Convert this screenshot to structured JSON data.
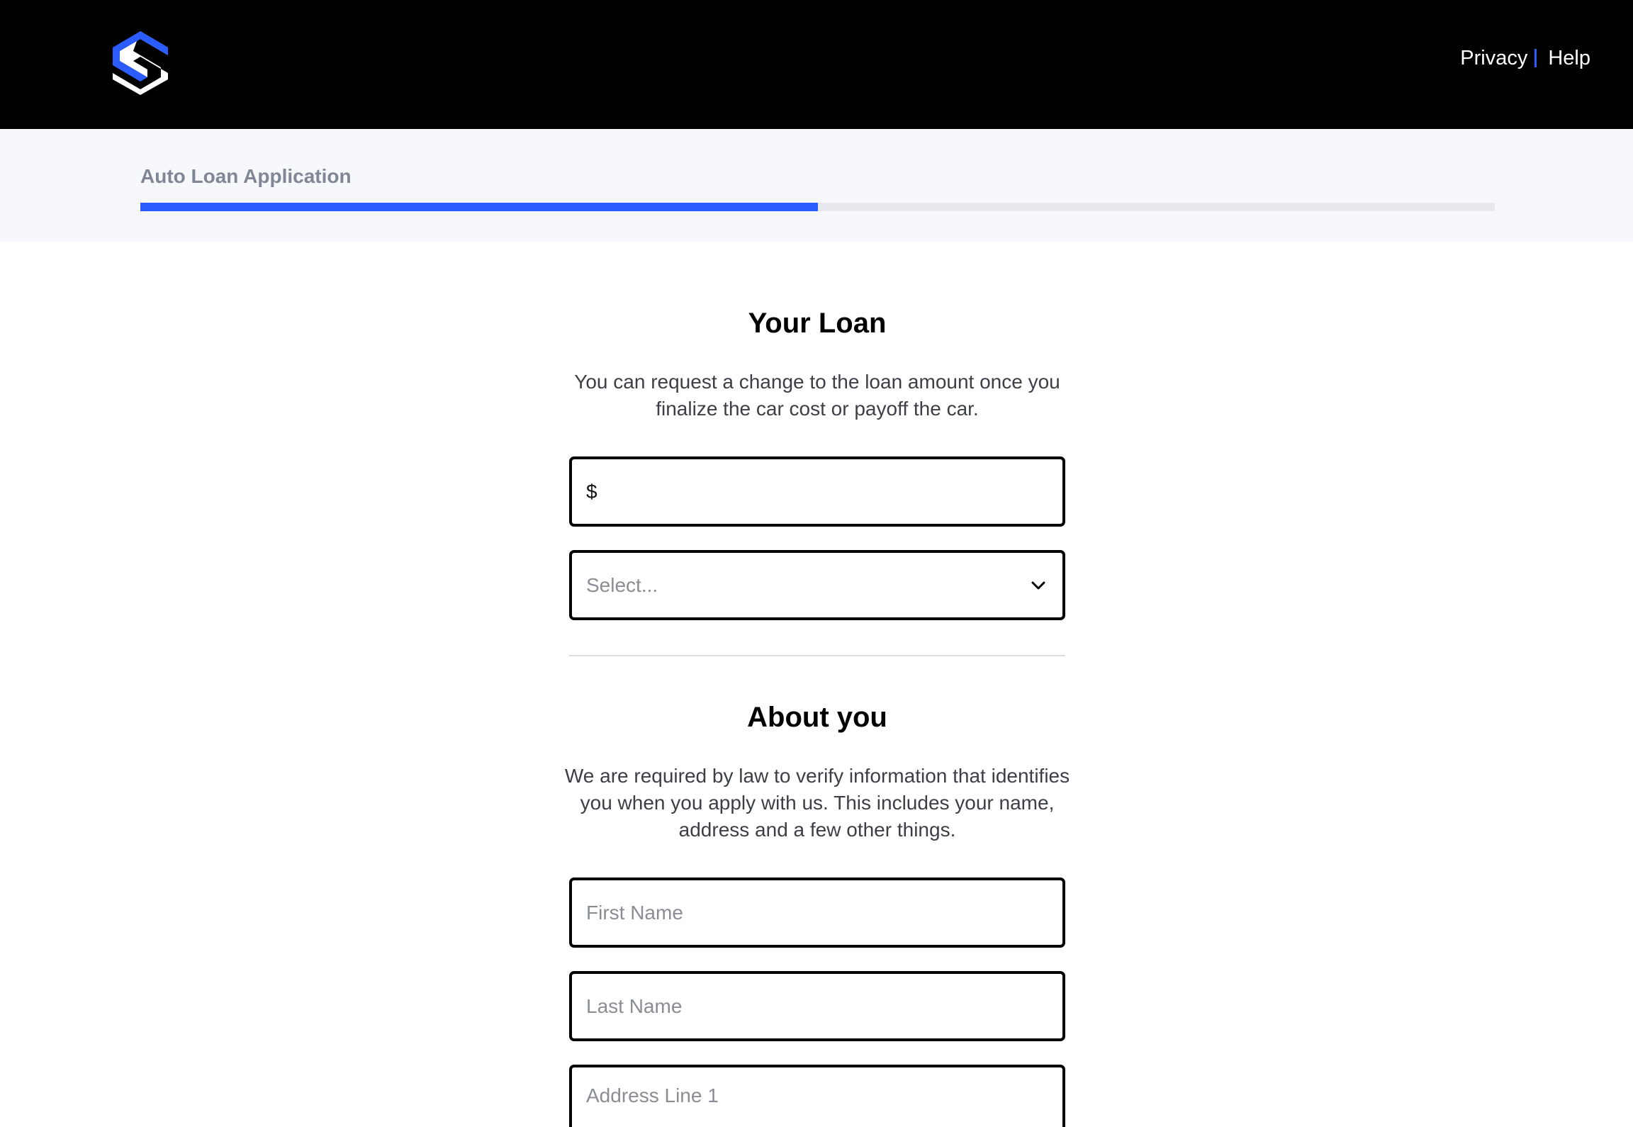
{
  "header": {
    "logo_name": "brand-logo",
    "links": [
      "Privacy",
      "Help"
    ],
    "accent_color": "#2a5cff"
  },
  "progress": {
    "title": "Auto Loan Application",
    "fraction": 0.5
  },
  "loan": {
    "title": "Your Loan",
    "description": "You can request a change to the loan amount once you finalize the car cost or payoff the car.",
    "amount_prefix": "$",
    "amount_value": "",
    "select_placeholder": "Select..."
  },
  "about": {
    "title": "About you",
    "description": "We are required by law to verify information that identifies you when you apply with us. This includes your name, address and a few other things.",
    "first_name_placeholder": "First Name",
    "last_name_placeholder": "Last Name",
    "address1_placeholder": "Address Line 1"
  }
}
